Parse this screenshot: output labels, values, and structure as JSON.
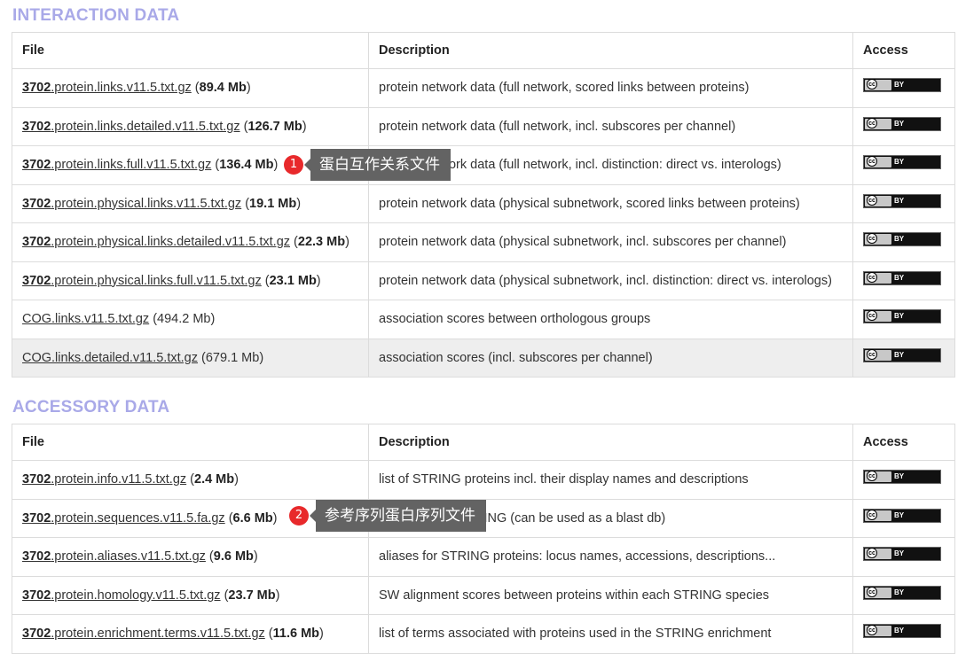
{
  "interaction": {
    "title": "INTERACTION DATA",
    "headers": {
      "file": "File",
      "description": "Description",
      "access": "Access"
    },
    "rows": [
      {
        "taxid": "3702",
        "name": ".protein.links.v11.5.txt.gz",
        "size": "89.4 Mb",
        "bold": true,
        "desc": "protein network data (full network, scored links between proteins)"
      },
      {
        "taxid": "3702",
        "name": ".protein.links.detailed.v11.5.txt.gz",
        "size": "126.7 Mb",
        "bold": true,
        "desc": "protein network data (full network, incl. subscores per channel)"
      },
      {
        "taxid": "3702",
        "name": ".protein.links.full.v11.5.txt.gz",
        "size": "136.4 Mb",
        "bold": true,
        "desc": "protein network data (full network, incl. distinction: direct vs. interologs)"
      },
      {
        "taxid": "3702",
        "name": ".protein.physical.links.v11.5.txt.gz",
        "size": "19.1 Mb",
        "bold": true,
        "desc": "protein network data (physical subnetwork, scored links between proteins)"
      },
      {
        "taxid": "3702",
        "name": ".protein.physical.links.detailed.v11.5.txt.gz",
        "size": "22.3 Mb",
        "bold": true,
        "desc": "protein network data (physical subnetwork, incl. subscores per channel)"
      },
      {
        "taxid": "3702",
        "name": ".protein.physical.links.full.v11.5.txt.gz",
        "size": "23.1 Mb",
        "bold": true,
        "desc": "protein network data (physical subnetwork, incl. distinction: direct vs. interologs)"
      },
      {
        "taxid": "",
        "name": "COG.links.v11.5.txt.gz",
        "size": "494.2 Mb",
        "bold": false,
        "desc": "association scores between orthologous groups"
      },
      {
        "taxid": "",
        "name": "COG.links.detailed.v11.5.txt.gz",
        "size": "679.1 Mb",
        "bold": false,
        "desc": "association scores (incl. subscores per channel)",
        "highlight": true
      }
    ]
  },
  "accessory": {
    "title": "ACCESSORY DATA",
    "headers": {
      "file": "File",
      "description": "Description",
      "access": "Access"
    },
    "rows": [
      {
        "taxid": "3702",
        "name": ".protein.info.v11.5.txt.gz",
        "size": "2.4 Mb",
        "bold": true,
        "desc": "list of STRING proteins incl. their display names and descriptions"
      },
      {
        "taxid": "3702",
        "name": ".protein.sequences.v11.5.fa.gz",
        "size": "6.6 Mb",
        "bold": true,
        "desc": "all proteins in STRING (can be used as a blast db)"
      },
      {
        "taxid": "3702",
        "name": ".protein.aliases.v11.5.txt.gz",
        "size": "9.6 Mb",
        "bold": true,
        "desc": "aliases for STRING proteins: locus names, accessions, descriptions..."
      },
      {
        "taxid": "3702",
        "name": ".protein.homology.v11.5.txt.gz",
        "size": "23.7 Mb",
        "bold": true,
        "desc": "SW alignment scores between proteins within each STRING species"
      },
      {
        "taxid": "3702",
        "name": ".protein.enrichment.terms.v11.5.txt.gz",
        "size": "11.6 Mb",
        "bold": true,
        "desc": "list of terms associated with proteins used in the STRING enrichment"
      }
    ]
  },
  "license": {
    "cc": "cc",
    "by": "BY"
  },
  "annotations": [
    {
      "number": "1",
      "text": "蛋白互作关系文件"
    },
    {
      "number": "2",
      "text": "参考序列蛋白序列文件"
    }
  ]
}
